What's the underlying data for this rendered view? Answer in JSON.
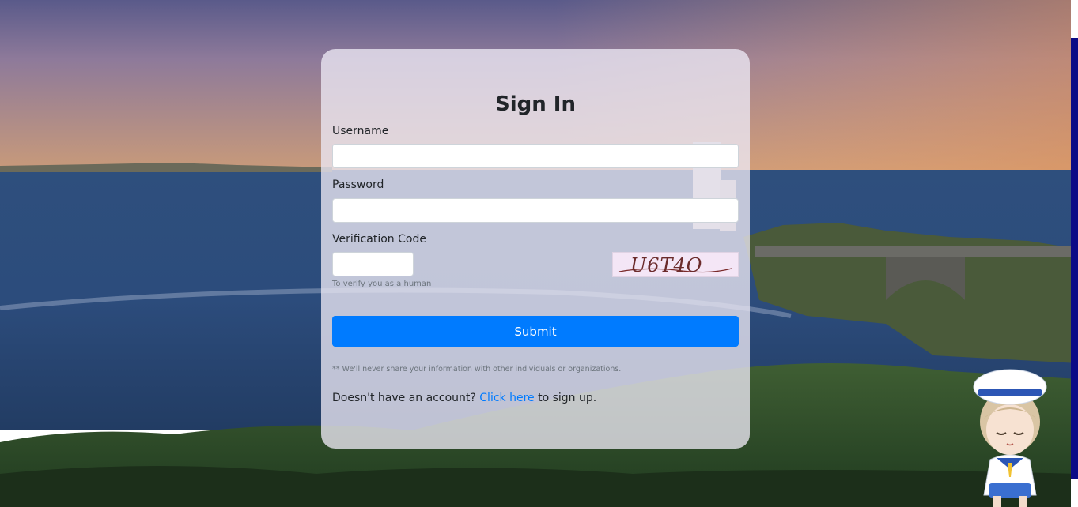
{
  "form": {
    "title": "Sign In",
    "username_label": "Username",
    "username_value": "",
    "password_label": "Password",
    "password_value": "",
    "code_label": "Verification Code",
    "code_value": "",
    "captcha_text": "U6T4O",
    "code_help": "To verify you as a human",
    "submit_label": "Submit",
    "privacy_note": "** We'll never share your information with other individuals or organizations.",
    "signup_prefix": "Doesn't have an account?",
    "signup_link": "Click here",
    "signup_suffix": "to sign up."
  },
  "colors": {
    "primary": "#007bff",
    "card_bg": "#ece8f4",
    "scrollbar": "#0b0b86"
  }
}
